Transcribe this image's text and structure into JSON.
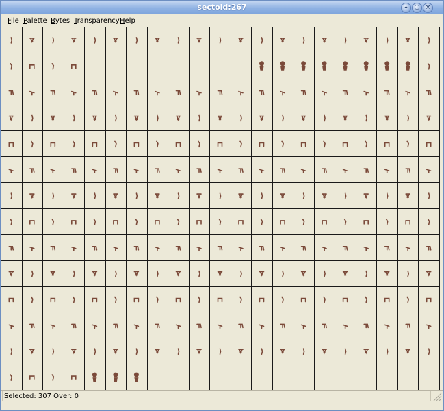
{
  "window": {
    "title": "sectoid:267"
  },
  "menu": [
    {
      "label": "File",
      "mnemonic": "F",
      "rest": "ile"
    },
    {
      "label": "Palette",
      "mnemonic": "P",
      "rest": "alette"
    },
    {
      "label": "Bytes",
      "mnemonic": "B",
      "rest": "ytes"
    },
    {
      "label": "Transparency",
      "mnemonic": "T",
      "rest": "ransparency"
    },
    {
      "label": "Help",
      "mnemonic": "H",
      "rest": "elp"
    }
  ],
  "grid": {
    "columns": 21,
    "rows": 14,
    "selected_index": 307,
    "sprite_color": "#7b4a3a",
    "highlight_color": "#d40000",
    "empty_cells": [
      [
        1,
        4
      ],
      [
        1,
        5
      ],
      [
        1,
        6
      ],
      [
        1,
        7
      ],
      [
        1,
        8
      ],
      [
        1,
        9
      ],
      [
        1,
        10
      ],
      [
        1,
        11
      ],
      [
        13,
        7
      ],
      [
        13,
        8
      ],
      [
        13,
        9
      ],
      [
        13,
        10
      ],
      [
        13,
        11
      ],
      [
        13,
        12
      ],
      [
        13,
        13
      ],
      [
        13,
        14
      ],
      [
        13,
        15
      ],
      [
        13,
        16
      ],
      [
        13,
        17
      ],
      [
        13,
        18
      ],
      [
        13,
        19
      ],
      [
        13,
        20
      ]
    ],
    "figure_cells": [
      [
        1,
        12
      ],
      [
        1,
        13
      ],
      [
        1,
        14
      ],
      [
        1,
        15
      ],
      [
        1,
        16
      ],
      [
        1,
        17
      ],
      [
        1,
        18
      ],
      [
        1,
        19
      ],
      [
        13,
        4
      ],
      [
        13,
        5
      ],
      [
        13,
        6
      ]
    ]
  },
  "status": {
    "text": "Selected: 307 Over: 0"
  }
}
